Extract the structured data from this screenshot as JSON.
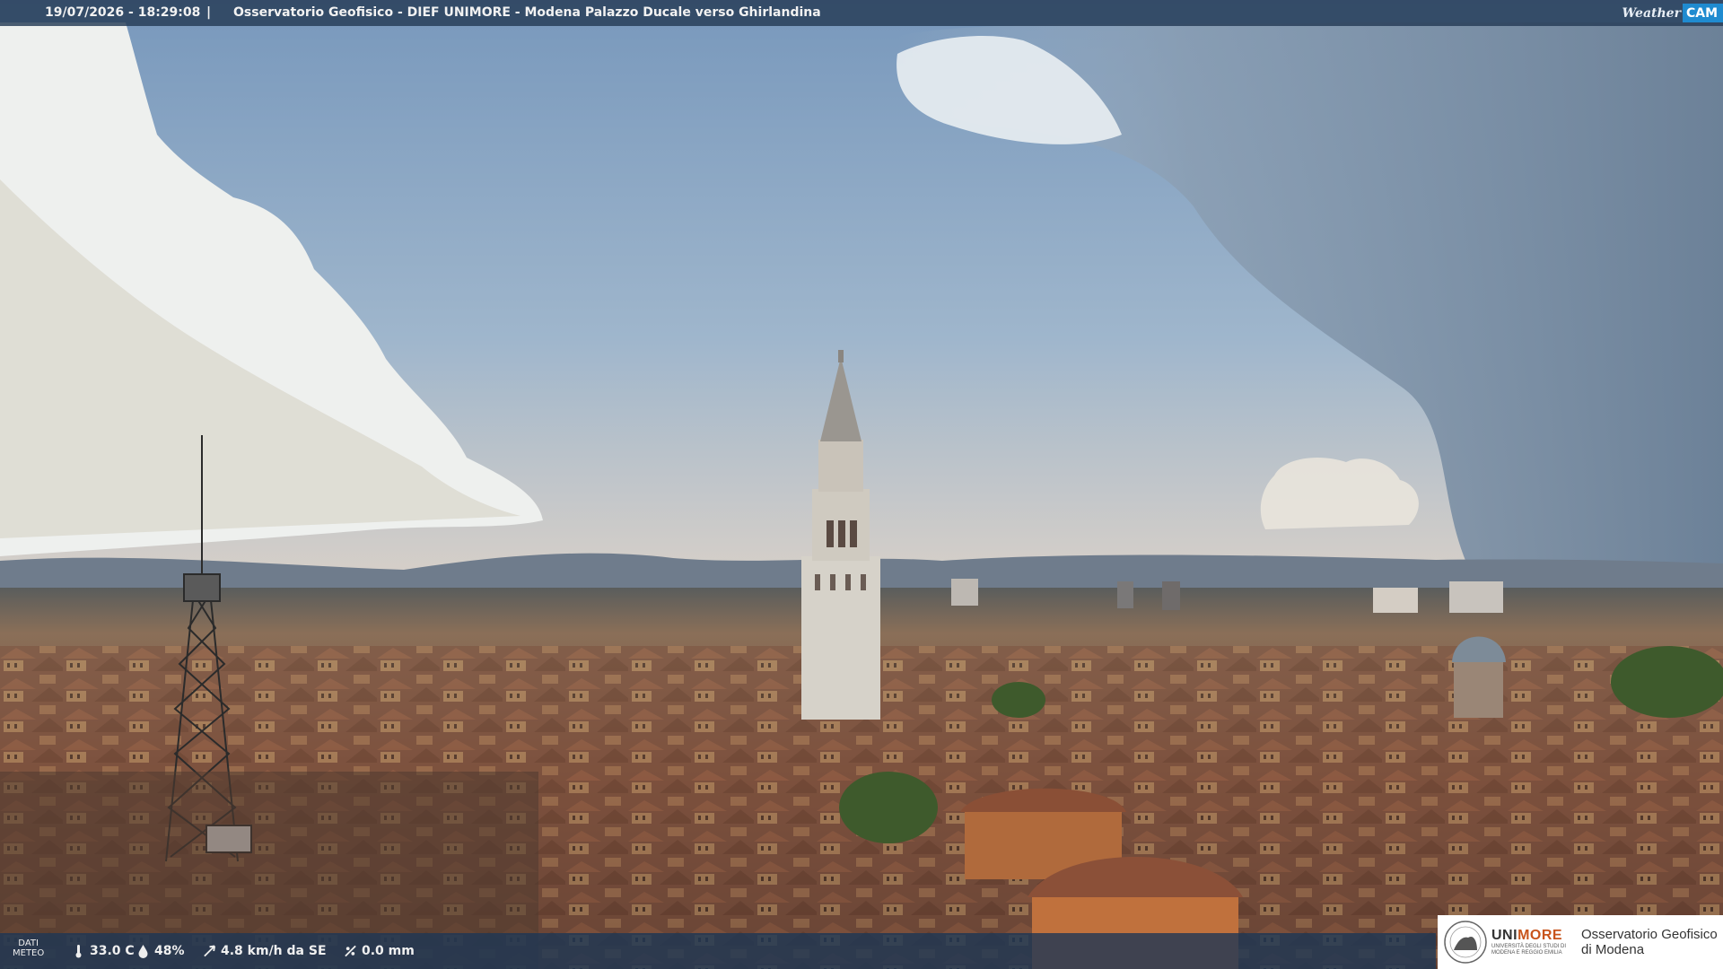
{
  "header": {
    "timestamp": "19/07/2026 - 18:29:08",
    "separator": "|",
    "title": "Osservatorio Geofisico - DIEF UNIMORE - Modena Palazzo Ducale verso Ghirlandina",
    "brand_weather": "Weather",
    "brand_cam": "CAM"
  },
  "meteo": {
    "label_line1": "DATI",
    "label_line2": "METEO",
    "temperature": "33.0 C",
    "humidity": "48%",
    "wind": "4.8 km/h da SE",
    "rain": "0.0 mm"
  },
  "logo": {
    "university": "UNIMORE",
    "university_highlight": "MORE",
    "university_sub1": "UNIVERSITÀ DEGLI STUDI DI",
    "university_sub2": "MODENA E REGGIO EMILIA",
    "observatory_line1": "Osservatorio Geofisico",
    "observatory_line2": "di Modena"
  },
  "colors": {
    "sky_top": "#7fa0c2",
    "sky_horizon": "#f1d2b8",
    "roof": "#8a5a44",
    "overlay": "#243a56",
    "brand_blue": "#1f8bd0",
    "unimore_orange": "#c8541c"
  }
}
